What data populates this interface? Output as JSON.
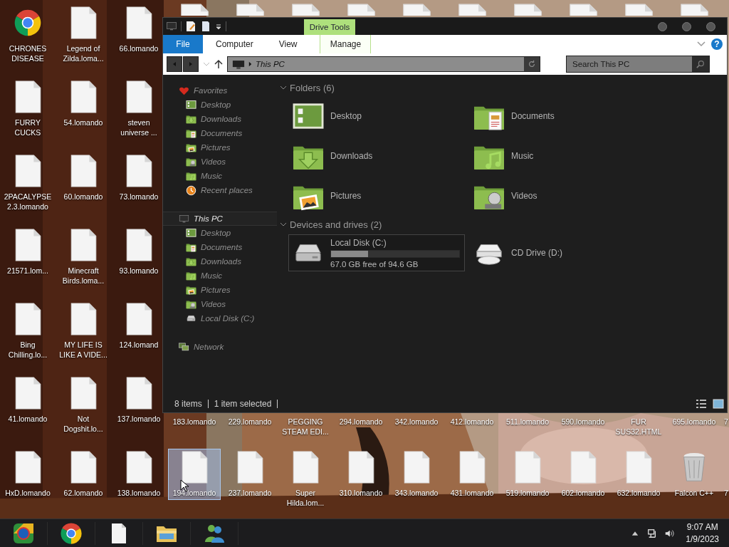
{
  "desktop": {
    "rows": [
      {
        "icons": [
          {
            "kind": "chrome",
            "label": "CHRONES DISEASE",
            "selected": false
          },
          {
            "kind": "file",
            "label": "Legend of Zilda.loma...",
            "selected": false
          },
          {
            "kind": "file",
            "label": "66.lomando",
            "selected": false
          },
          {
            "kind": "file",
            "selected": false
          },
          {
            "kind": "file",
            "selected": false
          },
          {
            "kind": "file",
            "selected": false
          },
          {
            "kind": "file",
            "selected": false
          },
          {
            "kind": "file",
            "selected": false
          },
          {
            "kind": "file",
            "selected": false
          },
          {
            "kind": "file",
            "selected": false
          },
          {
            "kind": "file",
            "selected": false
          },
          {
            "kind": "file",
            "selected": false
          },
          {
            "kind": "file",
            "selected": false
          }
        ]
      },
      {
        "icons": [
          {
            "kind": "file",
            "label": "FURRY CUCKS",
            "selected": false
          },
          {
            "kind": "file",
            "label": "54.lomando",
            "selected": false
          },
          {
            "kind": "file",
            "label": "steven universe ...",
            "selected": false
          }
        ]
      },
      {
        "icons": [
          {
            "kind": "file",
            "label": "2PACALYPSE 2.3.lomando",
            "selected": false
          },
          {
            "kind": "file",
            "label": "60.lomando",
            "selected": false
          },
          {
            "kind": "file",
            "label": "73.lomando",
            "selected": false
          }
        ]
      },
      {
        "icons": [
          {
            "kind": "file",
            "label": "21571.lom...",
            "selected": false
          },
          {
            "kind": "file",
            "label": "Minecraft Birds.loma...",
            "selected": false
          },
          {
            "kind": "file",
            "label": "93.lomando",
            "selected": false
          }
        ]
      },
      {
        "icons": [
          {
            "kind": "file",
            "label": "Bing Chilling.lo...",
            "selected": false
          },
          {
            "kind": "file",
            "label": "MY LIFE IS LIKE A VIDE...",
            "selected": false
          },
          {
            "kind": "file",
            "label": "124.lomand",
            "selected": false
          }
        ]
      },
      {
        "icons": [
          {
            "kind": "file",
            "label": "41.lomando",
            "selected": false
          },
          {
            "kind": "file",
            "label": "Not Dogshit.lo...",
            "selected": false
          },
          {
            "kind": "file",
            "label": "137.lomando",
            "selected": false
          },
          {
            "kind": "label_only",
            "label": "183.lomando",
            "selected": false
          },
          {
            "kind": "label_only",
            "label": "229.lomando",
            "selected": false
          },
          {
            "kind": "label_only",
            "label": "PEGGING STEAM EDI...",
            "selected": false
          },
          {
            "kind": "label_only",
            "label": "294.lomando",
            "selected": false
          },
          {
            "kind": "label_only",
            "label": "342.lomando",
            "selected": false
          },
          {
            "kind": "label_only",
            "label": "412.lomando",
            "selected": false
          },
          {
            "kind": "label_only",
            "label": "511.lomando",
            "selected": false
          },
          {
            "kind": "label_only",
            "label": "590.lomando",
            "selected": false
          },
          {
            "kind": "label_only",
            "label": "FUR SUS32.HTML",
            "selected": false
          },
          {
            "kind": "label_only",
            "label": "695.lomando",
            "selected": false
          },
          {
            "kind": "edge_label",
            "label": "7",
            "selected": false
          }
        ]
      },
      {
        "icons": [
          {
            "kind": "file",
            "label": "HxD.lomando",
            "selected": false
          },
          {
            "kind": "file",
            "label": "62.lomando",
            "selected": false
          },
          {
            "kind": "file",
            "label": "138.lomando",
            "selected": false
          },
          {
            "kind": "file",
            "label": "194.lomando",
            "selected": true
          },
          {
            "kind": "file",
            "label": "237.lomando",
            "selected": false
          },
          {
            "kind": "file",
            "label": "Super Hilda.lom...",
            "selected": false
          },
          {
            "kind": "file",
            "label": "310.lomando",
            "selected": false
          },
          {
            "kind": "file",
            "label": "343.lomando",
            "selected": false
          },
          {
            "kind": "file",
            "label": "431.lomando",
            "selected": false
          },
          {
            "kind": "file",
            "label": "519.lomando",
            "selected": false
          },
          {
            "kind": "file",
            "label": "602.lomando",
            "selected": false
          },
          {
            "kind": "file",
            "label": "632.lomando",
            "selected": false
          },
          {
            "kind": "recycle_bin",
            "label": "Falcon C++",
            "selected": false
          },
          {
            "kind": "edge_label",
            "label": "7",
            "selected": false
          }
        ]
      }
    ]
  },
  "window": {
    "ribbon": {
      "context_group": "Drive Tools",
      "tabs": [
        {
          "kind": "file_menu",
          "label": "File",
          "selected": false
        },
        {
          "kind": "tab",
          "label": "Computer",
          "selected": false
        },
        {
          "kind": "tab",
          "label": "View",
          "selected": false
        },
        {
          "kind": "context_tab",
          "label": "Manage",
          "selected": false
        }
      ],
      "help": "?"
    },
    "address": {
      "path": "This PC"
    },
    "search": {
      "placeholder": "Search This PC"
    },
    "navigation": [
      {
        "kind": "favorites",
        "label": "Favorites",
        "selected": false,
        "children": [
          {
            "kind": "desktop",
            "label": "Desktop",
            "selected": false
          },
          {
            "kind": "downloads",
            "label": "Downloads",
            "selected": false
          },
          {
            "kind": "documents",
            "label": "Documents",
            "selected": false
          },
          {
            "kind": "pictures",
            "label": "Pictures",
            "selected": false
          },
          {
            "kind": "videos",
            "label": "Videos",
            "selected": false
          },
          {
            "kind": "music",
            "label": "Music",
            "selected": false
          },
          {
            "kind": "recent",
            "label": "Recent places",
            "selected": false
          }
        ]
      },
      {
        "kind": "pc",
        "label": "This PC",
        "selected": true,
        "children": [
          {
            "kind": "desktop",
            "label": "Desktop",
            "selected": false
          },
          {
            "kind": "documents",
            "label": "Documents",
            "selected": false
          },
          {
            "kind": "downloads",
            "label": "Downloads",
            "selected": false
          },
          {
            "kind": "music",
            "label": "Music",
            "selected": false
          },
          {
            "kind": "pictures",
            "label": "Pictures",
            "selected": false
          },
          {
            "kind": "videos",
            "label": "Videos",
            "selected": false
          },
          {
            "kind": "disk",
            "label": "Local Disk (C:)",
            "selected": false
          }
        ]
      },
      {
        "kind": "network",
        "label": "Network",
        "selected": false
      }
    ],
    "groups": [
      {
        "title": "Folders (6)",
        "expanded": true,
        "items": [
          {
            "kind": "desktop",
            "label": "Desktop",
            "selected": false
          },
          {
            "kind": "documents",
            "label": "Documents",
            "selected": false
          },
          {
            "kind": "downloads",
            "label": "Downloads",
            "selected": false
          },
          {
            "kind": "music",
            "label": "Music",
            "selected": false
          },
          {
            "kind": "pictures",
            "label": "Pictures",
            "selected": false
          },
          {
            "kind": "videos",
            "label": "Videos",
            "selected": false
          }
        ]
      },
      {
        "title": "Devices and drives (2)",
        "expanded": true,
        "items": [
          {
            "kind": "disk",
            "label": "Local Disk (C:)",
            "level": 0.29,
            "free": "67.0 GB free of 94.6 GB",
            "selected": true
          },
          {
            "kind": "cd",
            "label": "CD Drive (D:)",
            "selected": false
          }
        ]
      }
    ],
    "status_bar": {
      "item_count": "8 items",
      "selection": "1 item selected"
    }
  },
  "taskbar": {
    "apps": [
      {
        "kind": "start"
      },
      {
        "kind": "chrome"
      },
      {
        "kind": "file"
      },
      {
        "kind": "explorer"
      },
      {
        "kind": "messenger"
      }
    ],
    "clock": {
      "time": "9:07 AM",
      "date": "1/9/2023"
    }
  }
}
